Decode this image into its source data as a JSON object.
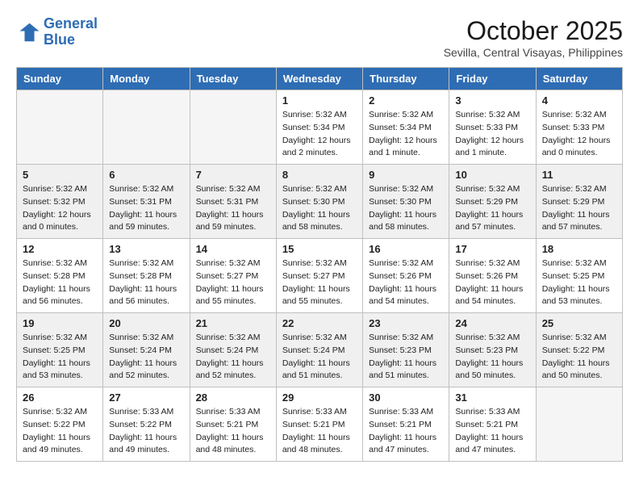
{
  "header": {
    "logo_line1": "General",
    "logo_line2": "Blue",
    "month": "October 2025",
    "location": "Sevilla, Central Visayas, Philippines"
  },
  "weekdays": [
    "Sunday",
    "Monday",
    "Tuesday",
    "Wednesday",
    "Thursday",
    "Friday",
    "Saturday"
  ],
  "weeks": [
    [
      {
        "day": "",
        "info": ""
      },
      {
        "day": "",
        "info": ""
      },
      {
        "day": "",
        "info": ""
      },
      {
        "day": "1",
        "info": "Sunrise: 5:32 AM\nSunset: 5:34 PM\nDaylight: 12 hours\nand 2 minutes."
      },
      {
        "day": "2",
        "info": "Sunrise: 5:32 AM\nSunset: 5:34 PM\nDaylight: 12 hours\nand 1 minute."
      },
      {
        "day": "3",
        "info": "Sunrise: 5:32 AM\nSunset: 5:33 PM\nDaylight: 12 hours\nand 1 minute."
      },
      {
        "day": "4",
        "info": "Sunrise: 5:32 AM\nSunset: 5:33 PM\nDaylight: 12 hours\nand 0 minutes."
      }
    ],
    [
      {
        "day": "5",
        "info": "Sunrise: 5:32 AM\nSunset: 5:32 PM\nDaylight: 12 hours\nand 0 minutes."
      },
      {
        "day": "6",
        "info": "Sunrise: 5:32 AM\nSunset: 5:31 PM\nDaylight: 11 hours\nand 59 minutes."
      },
      {
        "day": "7",
        "info": "Sunrise: 5:32 AM\nSunset: 5:31 PM\nDaylight: 11 hours\nand 59 minutes."
      },
      {
        "day": "8",
        "info": "Sunrise: 5:32 AM\nSunset: 5:30 PM\nDaylight: 11 hours\nand 58 minutes."
      },
      {
        "day": "9",
        "info": "Sunrise: 5:32 AM\nSunset: 5:30 PM\nDaylight: 11 hours\nand 58 minutes."
      },
      {
        "day": "10",
        "info": "Sunrise: 5:32 AM\nSunset: 5:29 PM\nDaylight: 11 hours\nand 57 minutes."
      },
      {
        "day": "11",
        "info": "Sunrise: 5:32 AM\nSunset: 5:29 PM\nDaylight: 11 hours\nand 57 minutes."
      }
    ],
    [
      {
        "day": "12",
        "info": "Sunrise: 5:32 AM\nSunset: 5:28 PM\nDaylight: 11 hours\nand 56 minutes."
      },
      {
        "day": "13",
        "info": "Sunrise: 5:32 AM\nSunset: 5:28 PM\nDaylight: 11 hours\nand 56 minutes."
      },
      {
        "day": "14",
        "info": "Sunrise: 5:32 AM\nSunset: 5:27 PM\nDaylight: 11 hours\nand 55 minutes."
      },
      {
        "day": "15",
        "info": "Sunrise: 5:32 AM\nSunset: 5:27 PM\nDaylight: 11 hours\nand 55 minutes."
      },
      {
        "day": "16",
        "info": "Sunrise: 5:32 AM\nSunset: 5:26 PM\nDaylight: 11 hours\nand 54 minutes."
      },
      {
        "day": "17",
        "info": "Sunrise: 5:32 AM\nSunset: 5:26 PM\nDaylight: 11 hours\nand 54 minutes."
      },
      {
        "day": "18",
        "info": "Sunrise: 5:32 AM\nSunset: 5:25 PM\nDaylight: 11 hours\nand 53 minutes."
      }
    ],
    [
      {
        "day": "19",
        "info": "Sunrise: 5:32 AM\nSunset: 5:25 PM\nDaylight: 11 hours\nand 53 minutes."
      },
      {
        "day": "20",
        "info": "Sunrise: 5:32 AM\nSunset: 5:24 PM\nDaylight: 11 hours\nand 52 minutes."
      },
      {
        "day": "21",
        "info": "Sunrise: 5:32 AM\nSunset: 5:24 PM\nDaylight: 11 hours\nand 52 minutes."
      },
      {
        "day": "22",
        "info": "Sunrise: 5:32 AM\nSunset: 5:24 PM\nDaylight: 11 hours\nand 51 minutes."
      },
      {
        "day": "23",
        "info": "Sunrise: 5:32 AM\nSunset: 5:23 PM\nDaylight: 11 hours\nand 51 minutes."
      },
      {
        "day": "24",
        "info": "Sunrise: 5:32 AM\nSunset: 5:23 PM\nDaylight: 11 hours\nand 50 minutes."
      },
      {
        "day": "25",
        "info": "Sunrise: 5:32 AM\nSunset: 5:22 PM\nDaylight: 11 hours\nand 50 minutes."
      }
    ],
    [
      {
        "day": "26",
        "info": "Sunrise: 5:32 AM\nSunset: 5:22 PM\nDaylight: 11 hours\nand 49 minutes."
      },
      {
        "day": "27",
        "info": "Sunrise: 5:33 AM\nSunset: 5:22 PM\nDaylight: 11 hours\nand 49 minutes."
      },
      {
        "day": "28",
        "info": "Sunrise: 5:33 AM\nSunset: 5:21 PM\nDaylight: 11 hours\nand 48 minutes."
      },
      {
        "day": "29",
        "info": "Sunrise: 5:33 AM\nSunset: 5:21 PM\nDaylight: 11 hours\nand 48 minutes."
      },
      {
        "day": "30",
        "info": "Sunrise: 5:33 AM\nSunset: 5:21 PM\nDaylight: 11 hours\nand 47 minutes."
      },
      {
        "day": "31",
        "info": "Sunrise: 5:33 AM\nSunset: 5:21 PM\nDaylight: 11 hours\nand 47 minutes."
      },
      {
        "day": "",
        "info": ""
      }
    ]
  ]
}
